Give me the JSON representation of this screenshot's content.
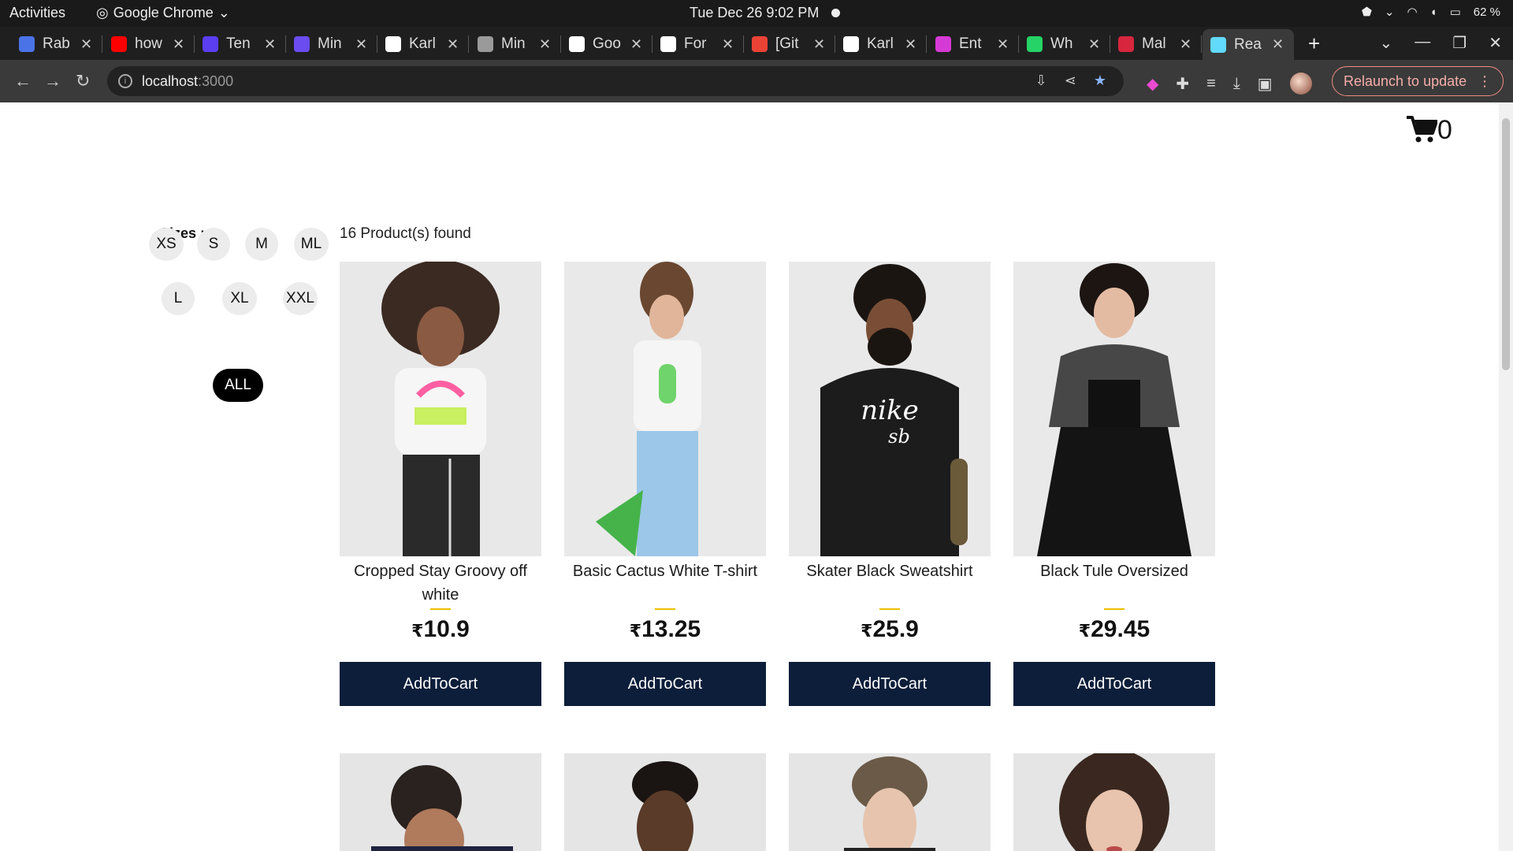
{
  "system": {
    "activities": "Activities",
    "app_name": "Google Chrome",
    "clock": "Tue Dec 26   9:02 PM",
    "battery": "62 %"
  },
  "tabs": [
    {
      "title": "Rab",
      "color": "#4a73e8"
    },
    {
      "title": "how",
      "color": "#ff0000"
    },
    {
      "title": "Ten",
      "color": "#5a3ef0"
    },
    {
      "title": "Min",
      "color": "#6a4cf0"
    },
    {
      "title": "Karl",
      "color": "#ffffff"
    },
    {
      "title": "Min",
      "color": "#9a9a9a"
    },
    {
      "title": "Goo",
      "color": "#ffffff"
    },
    {
      "title": "For",
      "color": "#ffffff"
    },
    {
      "title": "[Git",
      "color": "#ea4335"
    },
    {
      "title": "Karl",
      "color": "#ffffff"
    },
    {
      "title": "Ent",
      "color": "#d63ad6"
    },
    {
      "title": "Wh",
      "color": "#25d366"
    },
    {
      "title": "Mal",
      "color": "#d7263d"
    },
    {
      "title": "Rea",
      "color": "#61dafb"
    }
  ],
  "toolbar": {
    "url_host": "localhost",
    "url_port": ":3000",
    "relaunch_label": "Relaunch to update"
  },
  "cart": {
    "count": "0"
  },
  "filters": {
    "title": "Sizes :",
    "sizes": [
      "XS",
      "S",
      "M",
      "ML",
      "L",
      "XL",
      "XXL"
    ],
    "all_label": "ALL"
  },
  "products_found": "16 Product(s) found",
  "products": [
    {
      "name": "Cropped Stay Groovy off white",
      "currency": "₹",
      "price": "10.9",
      "button": "AddToCart"
    },
    {
      "name": "Basic Cactus White T-shirt",
      "currency": "₹",
      "price": "13.25",
      "button": "AddToCart"
    },
    {
      "name": "Skater Black Sweatshirt",
      "currency": "₹",
      "price": "25.9",
      "button": "AddToCart"
    },
    {
      "name": "Black Tule Oversized",
      "currency": "₹",
      "price": "29.45",
      "button": "AddToCart"
    }
  ]
}
